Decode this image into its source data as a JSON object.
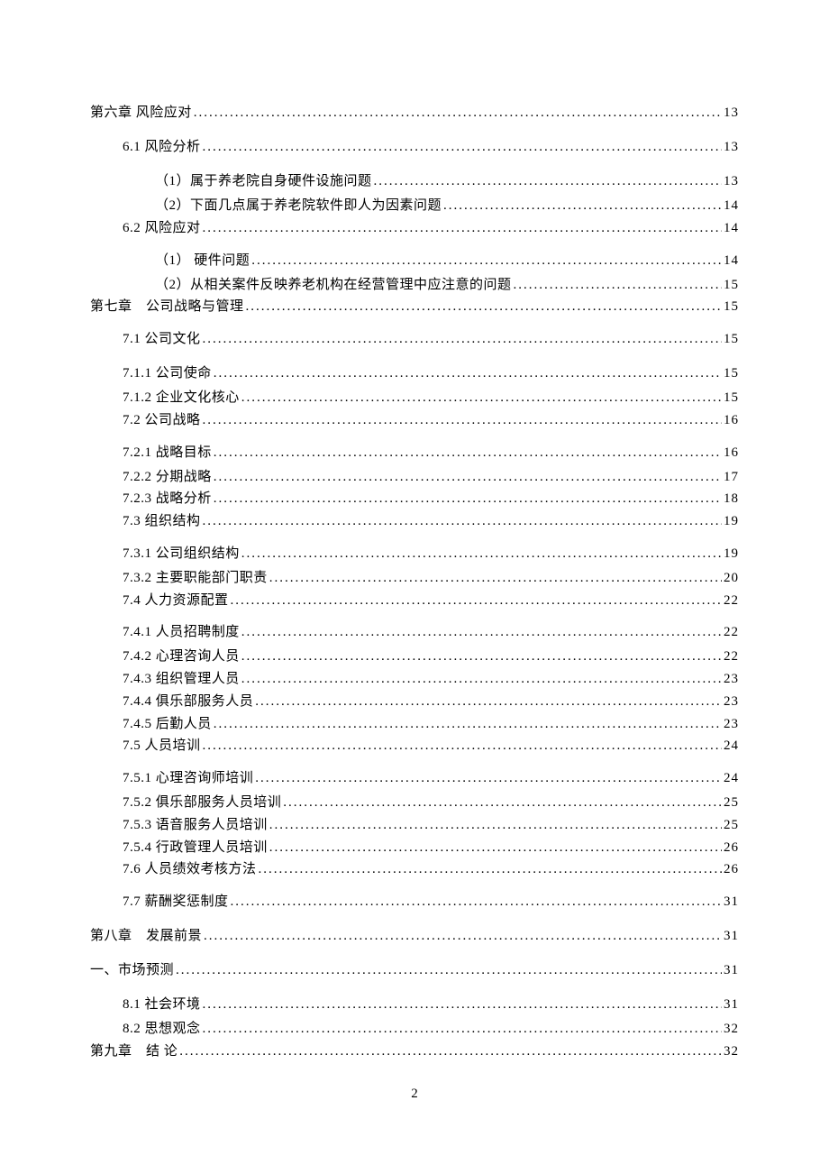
{
  "page_number_label": "2",
  "toc": [
    {
      "indent": 0,
      "label": "第六章 风险应对",
      "page": "13",
      "gapAbove": false
    },
    {
      "indent": 1,
      "label": "6.1 风险分析",
      "page": "13",
      "gapAbove": true
    },
    {
      "indent": 2,
      "label": "（1）属于养老院自身硬件设施问题",
      "page": "13",
      "gapAbove": true
    },
    {
      "indent": 2,
      "label": "（2）下面几点属于养老院软件即人为因素问题",
      "page": "14",
      "tight": true
    },
    {
      "indent": 1,
      "label": "6.2 风险应对",
      "page": "14",
      "tight": true
    },
    {
      "indent": 2,
      "label": "（1） 硬件问题",
      "page": "14",
      "gapAbove": true
    },
    {
      "indent": 2,
      "label": "（2）从相关案件反映养老机构在经营管理中应注意的问题",
      "page": "15",
      "tight": true
    },
    {
      "indent": 0,
      "label": "第七章　公司战略与管理",
      "page": "15",
      "tight": true
    },
    {
      "indent": 1,
      "label": "7.1 公司文化",
      "page": "15",
      "gapAbove": true
    },
    {
      "indent": 1,
      "label": "7.1.1 公司使命",
      "page": "15",
      "gapAbove": true
    },
    {
      "indent": 1,
      "label": "7.1.2 企业文化核心",
      "page": "15",
      "tight": true
    },
    {
      "indent": 1,
      "label": "7.2 公司战略",
      "page": "16",
      "tight": true
    },
    {
      "indent": 1,
      "label": "7.2.1 战略目标",
      "page": "16",
      "gapAbove": true
    },
    {
      "indent": 1,
      "label": "7.2.2 分期战略",
      "page": "17",
      "tight": true
    },
    {
      "indent": 1,
      "label": "7.2.3 战略分析",
      "page": "18",
      "tight": true
    },
    {
      "indent": 1,
      "label": "7.3 组织结构",
      "page": "19",
      "tight": true
    },
    {
      "indent": 1,
      "label": "7.3.1 公司组织结构",
      "page": "19",
      "gapAbove": true
    },
    {
      "indent": 1,
      "label": "7.3.2 主要职能部门职责",
      "page": "20",
      "tight": true
    },
    {
      "indent": 1,
      "label": "7.4 人力资源配置",
      "page": "22",
      "tight": true
    },
    {
      "indent": 1,
      "label": "7.4.1 人员招聘制度",
      "page": "22",
      "gapAbove": true
    },
    {
      "indent": 1,
      "label": "7.4.2 心理咨询人员",
      "page": "22",
      "tight": true
    },
    {
      "indent": 1,
      "label": "7.4.3 组织管理人员",
      "page": "23",
      "tight": true
    },
    {
      "indent": 1,
      "label": "7.4.4 俱乐部服务人员",
      "page": "23",
      "tight": true
    },
    {
      "indent": 1,
      "label": "7.4.5 后勤人员",
      "page": "23",
      "tight": true
    },
    {
      "indent": 1,
      "label": "7.5 人员培训",
      "page": "24",
      "tight": true
    },
    {
      "indent": 1,
      "label": "7.5.1 心理咨询师培训",
      "page": "24",
      "gapAbove": true
    },
    {
      "indent": 1,
      "label": "7.5.2 俱乐部服务人员培训",
      "page": "25",
      "tight": true
    },
    {
      "indent": 1,
      "label": "7.5.3 语音服务人员培训",
      "page": "25",
      "tight": true
    },
    {
      "indent": 1,
      "label": "7.5.4 行政管理人员培训",
      "page": "26",
      "tight": true
    },
    {
      "indent": 1,
      "label": "7.6 人员绩效考核方法",
      "page": "26",
      "tight": true
    },
    {
      "indent": 1,
      "label": "7.7 薪酬奖惩制度",
      "page": "31",
      "gapAbove": true
    },
    {
      "indent": 0,
      "label": "第八章　发展前景",
      "page": "31",
      "gapAbove": true
    },
    {
      "indent": 0,
      "label": "一、市场预测",
      "page": "31",
      "gapAbove": true
    },
    {
      "indent": 1,
      "label": "8.1 社会环境",
      "page": "31",
      "gapAbove": true
    },
    {
      "indent": 1,
      "label": "8.2 思想观念",
      "page": "32",
      "tight": true
    },
    {
      "indent": 0,
      "label": "第九章　结 论",
      "page": "32",
      "tight": true
    }
  ]
}
